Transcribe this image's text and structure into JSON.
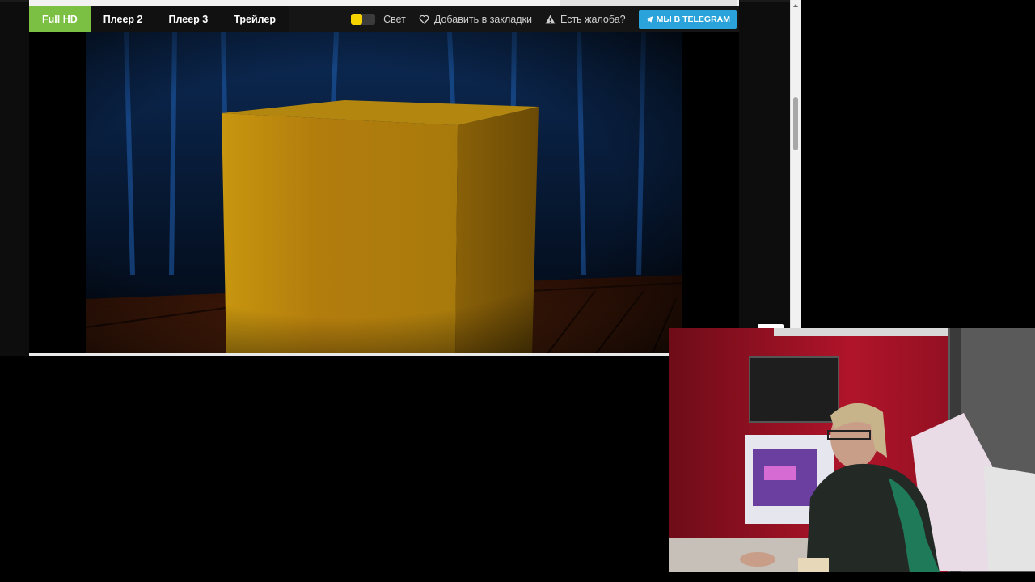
{
  "player": {
    "tabs": [
      {
        "label": "Full HD",
        "active": true
      },
      {
        "label": "Плеер 2",
        "active": false
      },
      {
        "label": "Плеер 3",
        "active": false
      },
      {
        "label": "Трейлер",
        "active": false
      }
    ],
    "light_label": "Свет",
    "bookmark_label": "Добавить в закладки",
    "complaint_label": "Есть жалоба?",
    "telegram_label": "МЫ В TELEGRAM"
  },
  "colors": {
    "active_tab": "#7bc043",
    "telegram": "#29a3d9",
    "toggle_dot": "#f4d300"
  },
  "icons": {
    "bookmark": "heart-icon",
    "complaint": "warning-icon",
    "telegram": "telegram-icon",
    "to_top": "arrow-up-icon"
  }
}
